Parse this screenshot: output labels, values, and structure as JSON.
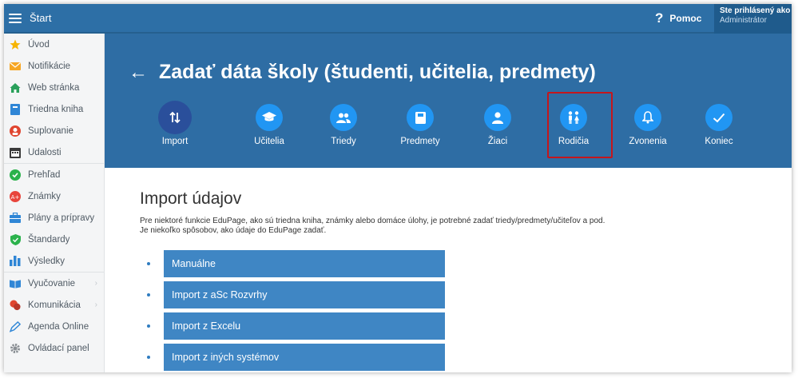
{
  "topbar": {
    "brand": "Štart",
    "help_label": "Pomoc",
    "user_line1": "Ste prihlásený ako",
    "user_line2": "Administrátor"
  },
  "sidebar": {
    "group1": [
      {
        "label": "Úvod",
        "icon": "star-icon",
        "color": "#f6b400"
      },
      {
        "label": "Notifikácie",
        "icon": "envelope-icon",
        "color": "#f6a623"
      },
      {
        "label": "Web stránka",
        "icon": "home-icon",
        "color": "#2aa05b"
      },
      {
        "label": "Triedna kniha",
        "icon": "book-icon",
        "color": "#2f86d6"
      },
      {
        "label": "Suplovanie",
        "icon": "substitution-icon",
        "color": "#e0452f"
      },
      {
        "label": "Udalosti",
        "icon": "calendar-icon",
        "color": "#3a3a3a"
      }
    ],
    "group2": [
      {
        "label": "Prehľad",
        "icon": "check-circle-icon",
        "color": "#2bb24c"
      },
      {
        "label": "Známky",
        "icon": "grade-icon",
        "color": "#e8453c"
      },
      {
        "label": "Plány a prípravy",
        "icon": "briefcase-icon",
        "color": "#2f86d6"
      },
      {
        "label": "Štandardy",
        "icon": "shield-icon",
        "color": "#2bb24c"
      },
      {
        "label": "Výsledky",
        "icon": "bar-chart-icon",
        "color": "#2f86d6"
      }
    ],
    "group3": [
      {
        "label": "Vyučovanie",
        "icon": "open-book-icon",
        "color": "#2f86d6",
        "chevron": "›"
      },
      {
        "label": "Komunikácia",
        "icon": "chat-icon",
        "color": "#e0452f",
        "chevron": "›"
      },
      {
        "label": "Agenda Online",
        "icon": "pen-icon",
        "color": "#2f86d6"
      },
      {
        "label": "Ovládací panel",
        "icon": "gear-icon",
        "color": "#8a8f94"
      }
    ]
  },
  "header": {
    "back_glyph": "🡐",
    "title": "Zadať dáta školy (študenti, učitelia, predmety)"
  },
  "steps": [
    {
      "label": "Import",
      "icon": "swap-arrows-icon",
      "glyph": "⇅",
      "active": true
    },
    {
      "label": "Učitelia",
      "icon": "graduation-cap-icon",
      "glyph": "🎓"
    },
    {
      "label": "Triedy",
      "icon": "group-icon",
      "glyph": "👥"
    },
    {
      "label": "Predmety",
      "icon": "book-icon",
      "glyph": "📘"
    },
    {
      "label": "Žiaci",
      "icon": "person-icon",
      "glyph": "👤"
    },
    {
      "label": "Rodičia",
      "icon": "parents-icon",
      "glyph": "👫",
      "highlighted": true
    },
    {
      "label": "Zvonenia",
      "icon": "bell-icon",
      "glyph": "🔔"
    },
    {
      "label": "Koniec",
      "icon": "check-icon",
      "glyph": "✓"
    }
  ],
  "main": {
    "section_title": "Import údajov",
    "desc_line1": "Pre niektoré funkcie EduPage, ako sú triedna kniha, známky alebo domáce úlohy, je potrebné zadať triedy/predmety/učiteľov a pod.",
    "desc_line2": "Je niekoľko spôsobov, ako údaje do EduPage zadať.",
    "options": [
      "Manuálne",
      "Import z aSc Rozvrhy",
      "Import z Excelu",
      "Import z iných systémov"
    ]
  },
  "colors": {
    "topbar": "#2d6fa6",
    "band": "#2e6da4",
    "step_circle": "#2196f3",
    "step_active": "#2a4f9b",
    "option_button": "#3f86c4",
    "highlight_border": "#c4161c"
  }
}
